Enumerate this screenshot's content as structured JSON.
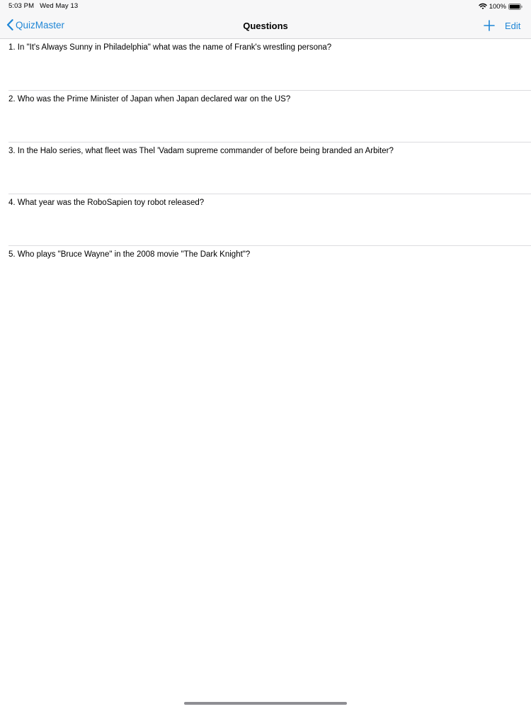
{
  "status_bar": {
    "time": "5:03 PM",
    "date": "Wed May 13",
    "battery": "100%"
  },
  "nav": {
    "back_label": "QuizMaster",
    "title": "Questions",
    "edit_label": "Edit"
  },
  "questions": [
    "1. In \"It's Always Sunny in Philadelphia\" what was the name of Frank's wrestling persona?",
    "2. Who was the Prime Minister of Japan when Japan declared war on the US?",
    "3. In the Halo series, what fleet was Thel 'Vadam supreme commander of before being branded an Arbiter?",
    "4. What year was the RoboSapien toy robot released?",
    "5. Who plays \"Bruce Wayne\" in the 2008 movie \"The Dark Knight\"?"
  ],
  "colors": {
    "accent": "#1f86d6",
    "bar_background": "#f7f7f8",
    "separator": "#dcdcdf"
  },
  "icons": {
    "back": "chevron-left-icon",
    "add": "plus-icon",
    "wifi": "wifi-icon",
    "battery": "battery-icon"
  }
}
